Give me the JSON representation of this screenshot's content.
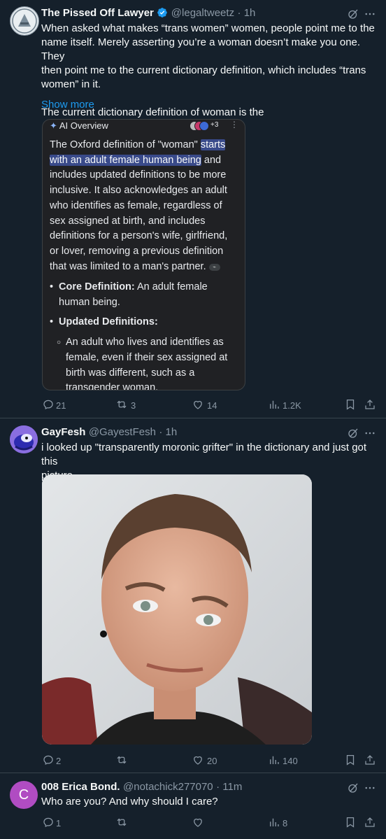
{
  "post1": {
    "name": "The Pissed Off Lawyer",
    "handle": "@legaltweetz",
    "time": "· 1h",
    "text": [
      "When asked what makes “trans women” women, people point me to the",
      "name itself. Merely asserting you’re a woman doesn’t make you one. They",
      "then point me to the current dictionary definition, which includes “trans",
      "women” in it.",
      "",
      "The current dictionary definition of woman is the"
    ],
    "show_more": "Show more",
    "ai_card": {
      "title": "AI Overview",
      "source_count": "+3",
      "para_before": "The Oxford definition of \"woman\" ",
      "para_highlight_1": "starts",
      "para_highlight_2": "with an adult female human being",
      "para_after_lines": [
        "and",
        "includes updated definitions to be more",
        "inclusive. It also acknowledges an adult",
        "who identifies as female, regardless of",
        "sex assigned at birth, and includes",
        "definitions for a person's wife, girlfriend,",
        "or lover, removing a previous definition",
        "that was limited to a man's partner."
      ],
      "bullet1_label": "Core Definition:",
      "bullet1_text_a": " An adult female",
      "bullet1_text_b": "human being.",
      "bullet2_label": "Updated Definitions:",
      "sub_bullet": [
        "An adult who lives and identifies as",
        "female, even if their sex assigned at",
        "birth was different, such as a",
        "transgender woman."
      ]
    },
    "actions": {
      "replies": "21",
      "reposts": "3",
      "likes": "14",
      "views": "1.2K"
    }
  },
  "post2": {
    "name": "GayFesh",
    "handle": "@GayestFesh",
    "time": "· 1h",
    "text": [
      "i looked up \"transparently moronic grifter\" in the dictionary and just got this",
      "picture"
    ],
    "actions": {
      "replies": "2",
      "reposts": "",
      "likes": "20",
      "views": "140"
    }
  },
  "post3": {
    "avatar_letter": "C",
    "name": "008 Erica Bond.",
    "handle": "@notachick277070",
    "time": "· 11m",
    "text": "Who are you? And why should I care?",
    "actions": {
      "replies": "1",
      "reposts": "",
      "likes": "",
      "views": "8"
    }
  },
  "colors": {
    "background": "#15202b",
    "accent": "#1d9bf0",
    "verified": "#1d9bf0",
    "avatar3": "#b04cc2"
  },
  "icons": [
    "grok-icon",
    "more-icon",
    "reply-icon",
    "repost-icon",
    "like-icon",
    "views-icon",
    "bookmark-icon",
    "share-icon",
    "verified-badge-icon",
    "sparkle-icon",
    "link-icon"
  ]
}
